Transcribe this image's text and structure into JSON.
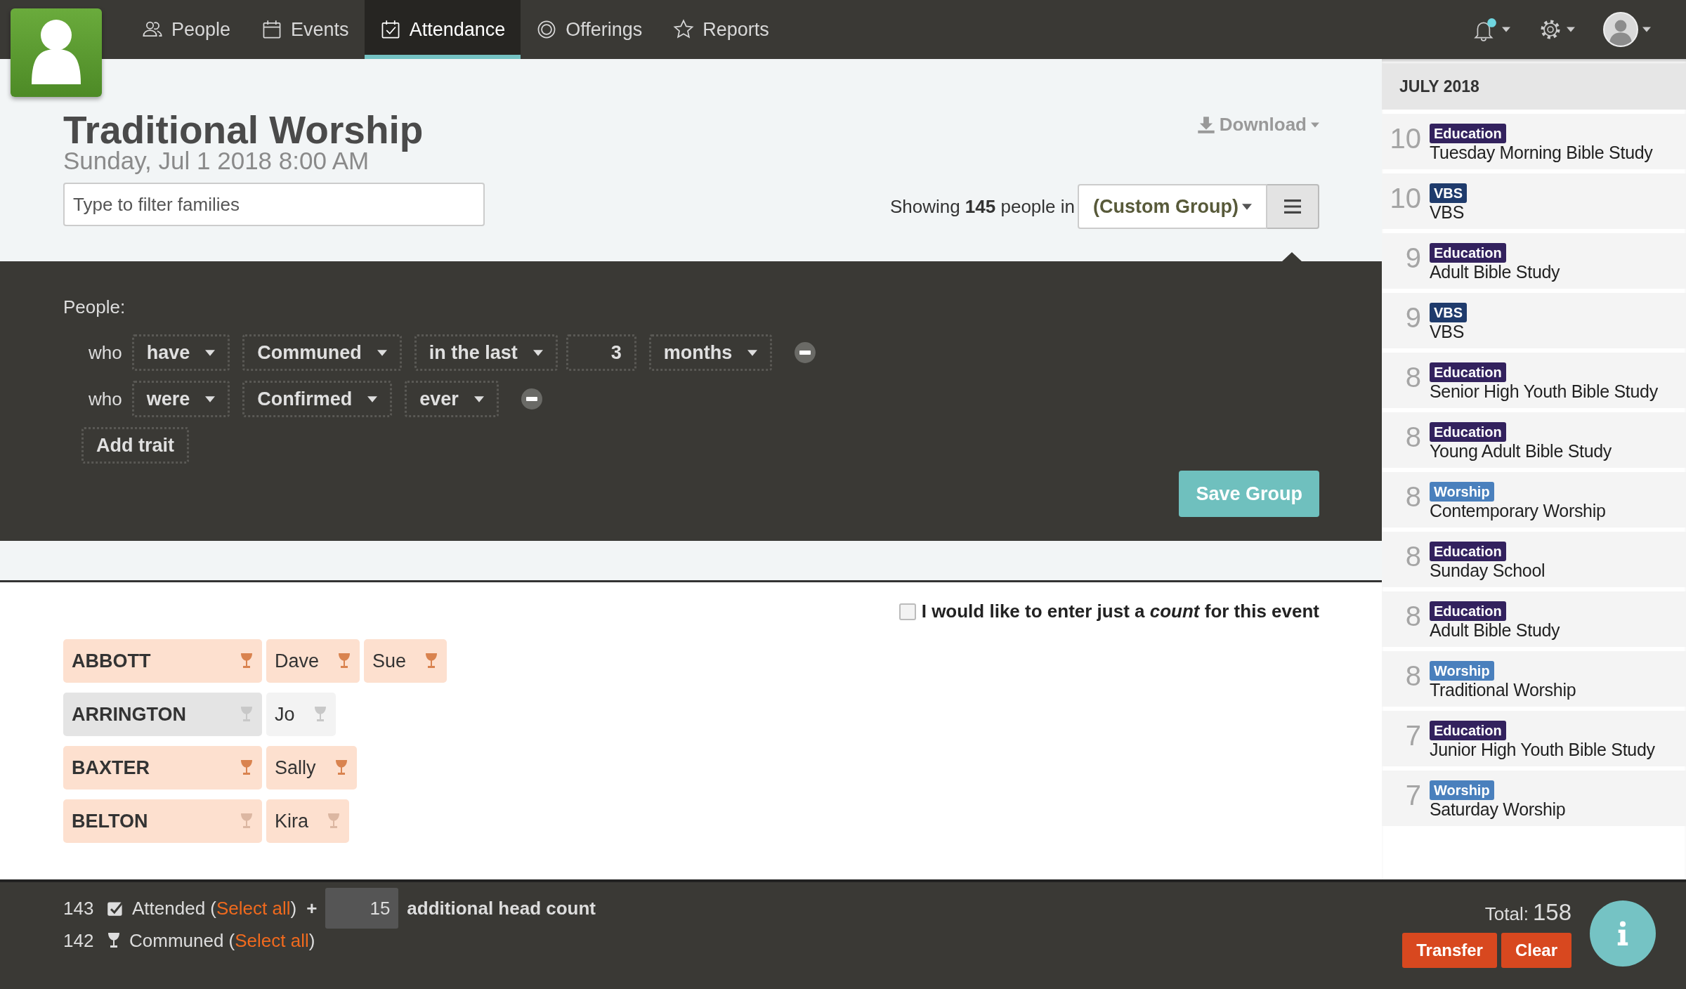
{
  "nav": {
    "items": [
      {
        "label": "People",
        "selected": false
      },
      {
        "label": "Events",
        "selected": false
      },
      {
        "label": "Attendance",
        "selected": true
      },
      {
        "label": "Offerings",
        "selected": false
      },
      {
        "label": "Reports",
        "selected": false
      }
    ],
    "notifications": {
      "unread": true
    }
  },
  "header": {
    "title": "Traditional Worship",
    "date": "Sunday, Jul 1 2018 8:00 AM",
    "filter": {
      "placeholder": "Type to filter families"
    },
    "download": "Download",
    "showing": "Showing **145** people in",
    "group": "(Custom Group)"
  },
  "group_panel": {
    "label": "People:",
    "traits": [
      {
        "prefix": "who",
        "parts": [
          {
            "kind": "select",
            "value": "have"
          },
          {
            "kind": "select",
            "value": "Communed"
          },
          {
            "kind": "select",
            "value": "in the last"
          },
          {
            "kind": "number",
            "value": "3"
          },
          {
            "kind": "select",
            "value": "months"
          }
        ]
      },
      {
        "prefix": "who",
        "parts": [
          {
            "kind": "select",
            "value": "were"
          },
          {
            "kind": "select",
            "value": "Confirmed"
          },
          {
            "kind": "select",
            "value": "ever"
          }
        ]
      }
    ],
    "add_trait": "Add trait",
    "save": "Save Group"
  },
  "count_option": {
    "label": "I would like to enter just a *count* for this event",
    "checked": false
  },
  "families": [
    {
      "name": "ABBOTT",
      "attended": true,
      "communed": true,
      "members": [
        {
          "name": "Dave",
          "attended": true,
          "communed": true
        },
        {
          "name": "Sue",
          "attended": true,
          "communed": true
        }
      ]
    },
    {
      "name": "ARRINGTON",
      "attended": false,
      "communed": false,
      "members": [
        {
          "name": "Jo",
          "attended": false,
          "communed": false
        }
      ]
    },
    {
      "name": "BAXTER",
      "attended": true,
      "communed": true,
      "members": [
        {
          "name": "Sally",
          "attended": true,
          "communed": true
        }
      ]
    },
    {
      "name": "BELTON",
      "attended": true,
      "communed": false,
      "members": [
        {
          "name": "Kira",
          "attended": true,
          "communed": false
        }
      ]
    }
  ],
  "footer": {
    "rows": [
      {
        "count": "143",
        "label": "Attended (",
        "link": "Select all",
        "after": ")"
      },
      {
        "count": "142",
        "label": "Communed (",
        "link": "Select all",
        "after": ")"
      }
    ],
    "plus": "+",
    "head_count": "15",
    "head_count_label": "additional head count",
    "total_label": "Total:",
    "total": "158",
    "buttons": [
      "Transfer",
      "Clear"
    ]
  },
  "sidebar": {
    "month": "JULY 2018",
    "events": [
      {
        "day": "10",
        "category": "Education",
        "color": "#33225e",
        "name": "Tuesday Morning Bible Study"
      },
      {
        "day": "10",
        "category": "VBS",
        "color": "#1f3b6c",
        "name": "VBS"
      },
      {
        "day": "9",
        "category": "Education",
        "color": "#33225e",
        "name": "Adult Bible Study"
      },
      {
        "day": "9",
        "category": "VBS",
        "color": "#1f3b6c",
        "name": "VBS"
      },
      {
        "day": "8",
        "category": "Education",
        "color": "#33225e",
        "name": "Senior High Youth Bible Study"
      },
      {
        "day": "8",
        "category": "Education",
        "color": "#33225e",
        "name": "Young Adult Bible Study"
      },
      {
        "day": "8",
        "category": "Worship",
        "color": "#4a80bd",
        "name": "Contemporary Worship"
      },
      {
        "day": "8",
        "category": "Education",
        "color": "#33225e",
        "name": "Sunday School"
      },
      {
        "day": "8",
        "category": "Education",
        "color": "#33225e",
        "name": "Adult Bible Study"
      },
      {
        "day": "8",
        "category": "Worship",
        "color": "#4a80bd",
        "name": "Traditional Worship"
      },
      {
        "day": "7",
        "category": "Education",
        "color": "#33225e",
        "name": "Junior High Youth Bible Study"
      },
      {
        "day": "7",
        "category": "Worship",
        "color": "#4a80bd",
        "name": "Saturday Worship"
      }
    ]
  }
}
